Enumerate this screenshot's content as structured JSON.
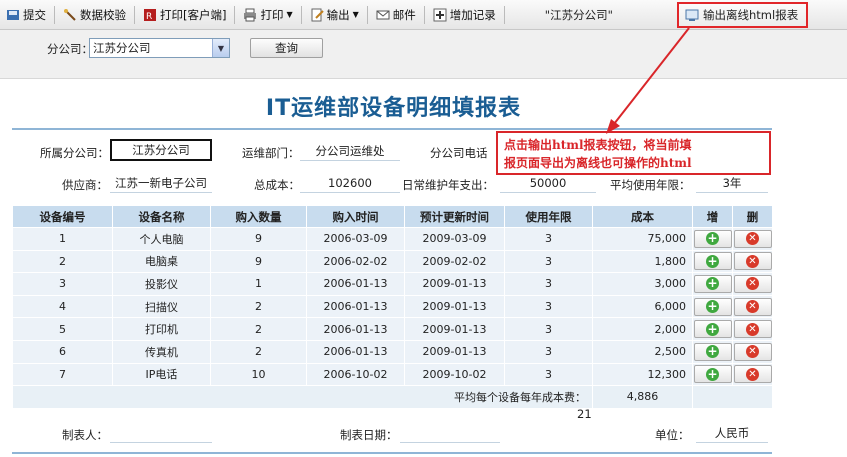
{
  "toolbar": {
    "submit": "提交",
    "validate": "数据校验",
    "print_client": "打印[客户端]",
    "print": "打印",
    "output": "输出",
    "mail": "邮件",
    "add_record": "增加记录",
    "company_title": "\"江苏分公司\"",
    "export_html": "输出离线html报表"
  },
  "filter": {
    "label": "分公司：",
    "selected": "江苏分公司",
    "query_button": "查询"
  },
  "report": {
    "title": "IT运维部设备明细填报表",
    "fields": {
      "company_label": "所属分公司：",
      "company_value": "江苏分公司",
      "dept_label": "运维部门：",
      "dept_value": "分公司运维处",
      "phone_label": "分公司电话",
      "supplier_label": "供应商：",
      "supplier_value": "江苏一新电子公司",
      "total_cost_label": "总成本：",
      "total_cost_value": "102600",
      "maint_label": "日常维护年支出：",
      "maint_value": "50000",
      "avg_years_label": "平均使用年限：",
      "avg_years_value": "3年"
    },
    "columns": [
      "设备编号",
      "设备名称",
      "购入数量",
      "购入时间",
      "预计更新时间",
      "使用年限",
      "成本",
      "增",
      "删"
    ],
    "rows": [
      [
        "1",
        "个人电脑",
        "9",
        "2006-03-09",
        "2009-03-09",
        "3",
        "75,000"
      ],
      [
        "2",
        "电脑桌",
        "9",
        "2006-02-02",
        "2009-02-02",
        "3",
        "1,800"
      ],
      [
        "3",
        "投影仪",
        "1",
        "2006-01-13",
        "2009-01-13",
        "3",
        "3,000"
      ],
      [
        "4",
        "扫描仪",
        "2",
        "2006-01-13",
        "2009-01-13",
        "3",
        "6,000"
      ],
      [
        "5",
        "打印机",
        "2",
        "2006-01-13",
        "2009-01-13",
        "3",
        "2,000"
      ],
      [
        "6",
        "传真机",
        "2",
        "2006-01-13",
        "2009-01-13",
        "3",
        "2,500"
      ],
      [
        "7",
        "IP电话",
        "10",
        "2006-10-02",
        "2009-10-02",
        "3",
        "12,300"
      ]
    ],
    "summary_label": "平均每个设备每年成本费：",
    "summary_value": "4,886",
    "row_count": "21",
    "footer": {
      "maker_label": "制表人：",
      "date_label": "制表日期：",
      "unit_label": "单位：",
      "unit_value": "人民币"
    }
  },
  "callout": {
    "line1": "点击输出html报表按钮，将当前填",
    "line2": "报页面导出为离线也可操作的html"
  },
  "colors": {
    "title": "#1a5d93",
    "header_bg": "#c8dcee",
    "row_bg": "#ecf2f8",
    "accent_red": "#d9262a"
  }
}
